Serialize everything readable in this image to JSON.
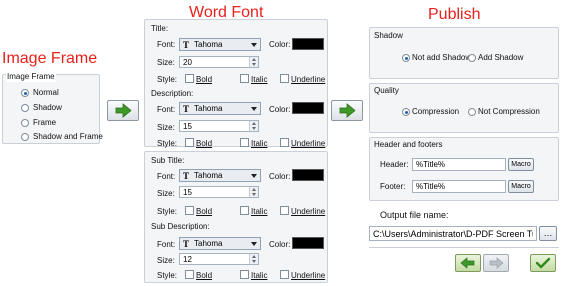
{
  "headings": {
    "image_frame": "Image Frame",
    "word_font": "Word Font",
    "publish": "Publish"
  },
  "image_frame": {
    "group_label": "Image Frame",
    "options": [
      "Normal",
      "Shadow",
      "Frame",
      "Shadow and Frame"
    ],
    "selected": "Normal"
  },
  "font_labels": {
    "font": "Font:",
    "size": "Size:",
    "style": "Style:",
    "color": "Color:",
    "bold": "Bold",
    "italic": "Italic",
    "underline": "Underline"
  },
  "title": {
    "label": "Title:",
    "font": "Tahoma",
    "size": "20",
    "color": "#000000"
  },
  "description": {
    "label": "Description:",
    "font": "Tahoma",
    "size": "15",
    "color": "#000000"
  },
  "sub_title": {
    "label": "Sub Title:",
    "font": "Tahoma",
    "size": "15",
    "color": "#000000"
  },
  "sub_description": {
    "label": "Sub Description:",
    "font": "Tahoma",
    "size": "12",
    "color": "#000000"
  },
  "shadow": {
    "label": "Shadow",
    "options": [
      "Not add Shadow",
      "Add Shadow"
    ],
    "selected": "Not add Shadow"
  },
  "quality": {
    "label": "Quality",
    "options": [
      "Compression",
      "Not Compression"
    ],
    "selected": "Compression"
  },
  "header_footers": {
    "label": "Header and footers",
    "header_label": "Header:",
    "header_value": "%Title%",
    "footer_label": "Footer:",
    "footer_value": "%Title%",
    "macro": "Macro"
  },
  "output": {
    "label": "Output file name:",
    "value": "C:\\Users\\Administrator\\D-PDF Screen Tutor"
  },
  "icons": {
    "forward": "green-right-arrow-icon",
    "back": "green-left-arrow-icon",
    "check": "green-check-icon",
    "browse": "ellipsis-icon"
  },
  "colors": {
    "heading_red": "#e8211c",
    "arrow_green": "#3e9a28"
  }
}
